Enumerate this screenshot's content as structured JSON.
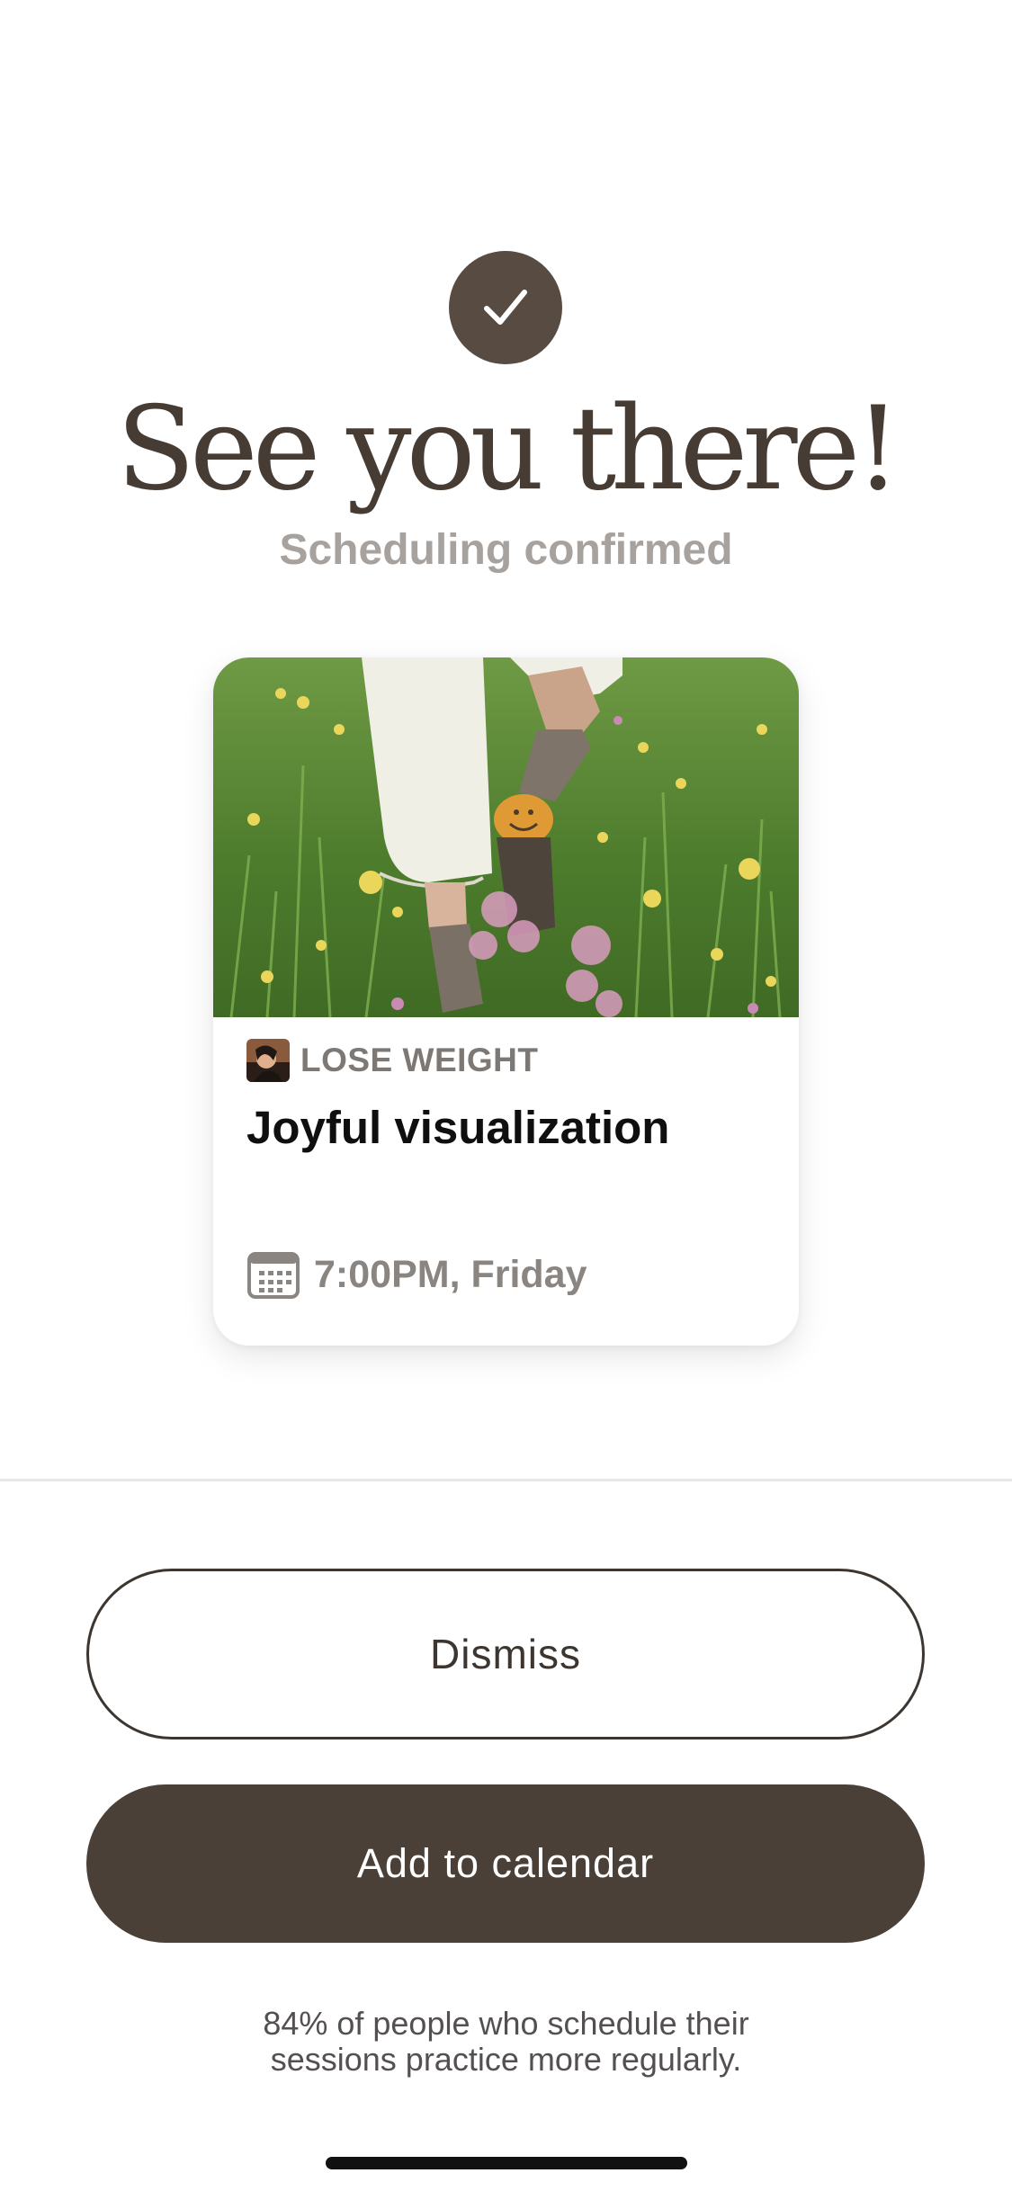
{
  "confirmation": {
    "icon": "checkmark-icon",
    "headline": "See you there!",
    "subheadline": "Scheduling confirmed"
  },
  "session_card": {
    "image": "meadow-walking-photo",
    "category_icon": "category-thumbnail",
    "category": "LOSE WEIGHT",
    "title": "Joyful visualization",
    "time_icon": "calendar-icon",
    "time": "7:00PM, Friday"
  },
  "actions": {
    "dismiss_label": "Dismiss",
    "add_to_calendar_label": "Add to calendar"
  },
  "footnote": {
    "line1": "84% of people who schedule their",
    "line2": "sessions practice more regularly."
  },
  "colors": {
    "primary": "#4a4037",
    "muted_text": "#a7a29d",
    "background": "#ffffff"
  }
}
